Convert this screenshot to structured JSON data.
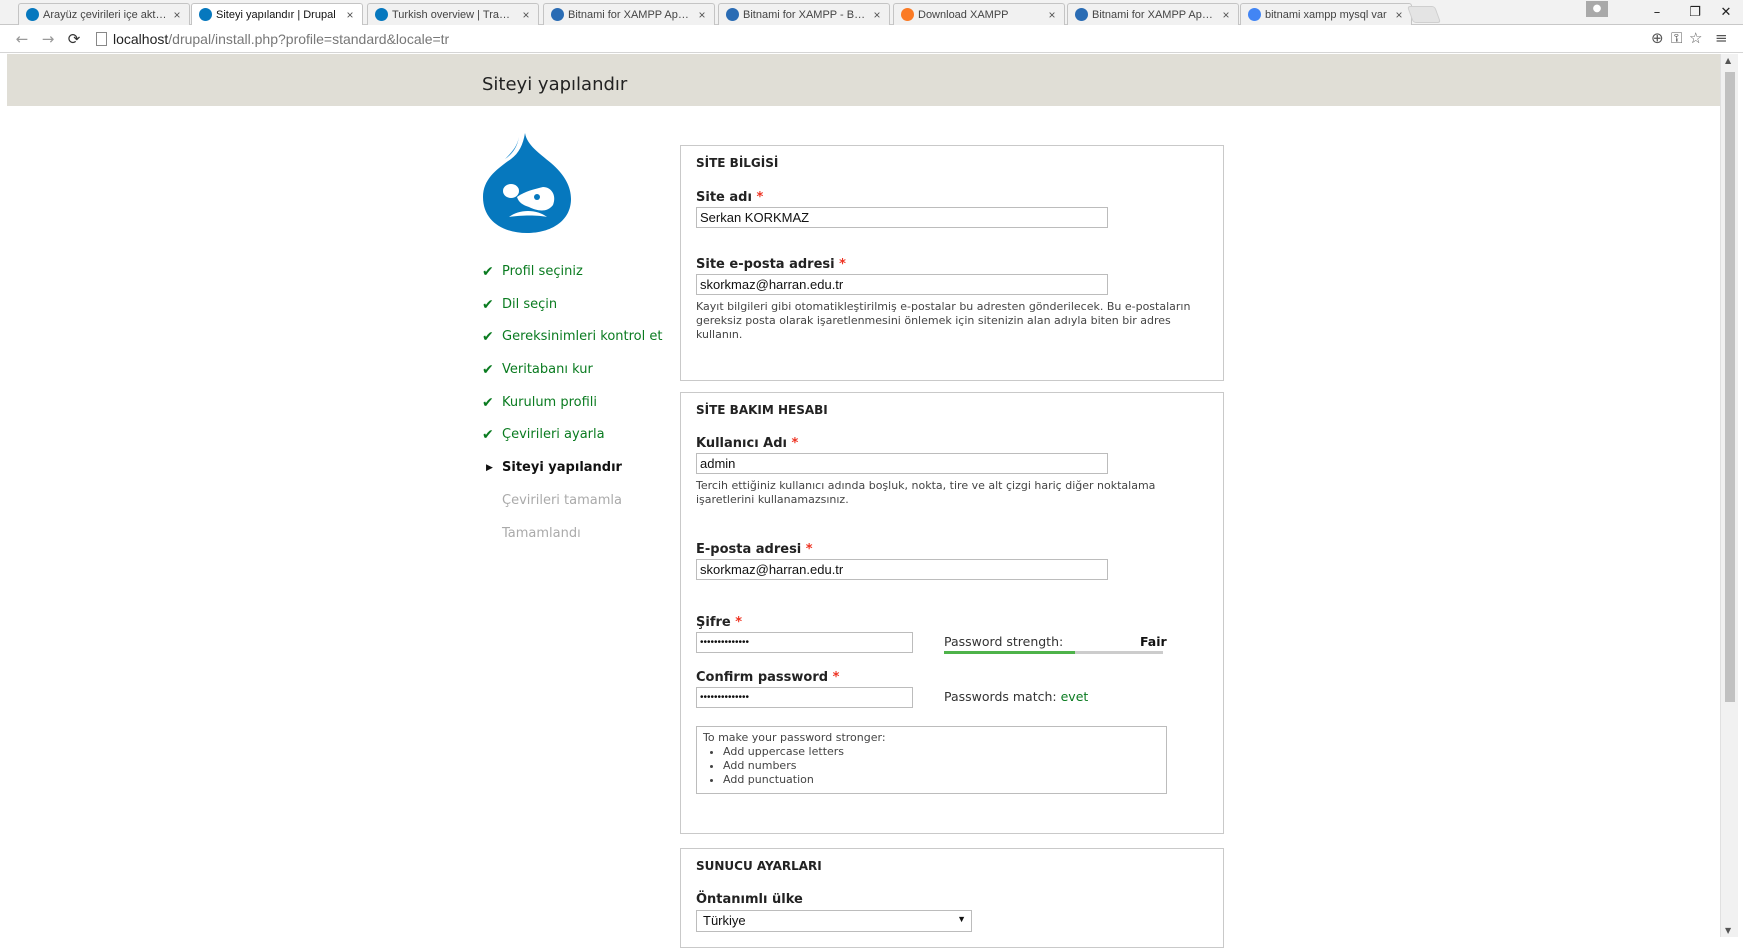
{
  "browser": {
    "tabs": [
      {
        "label": "Arayüz çevirileri içe aktarıl",
        "favicon": "drupal-icon",
        "color": "#0678be",
        "active": false
      },
      {
        "label": "Siteyi yapılandır | Drupal",
        "favicon": "drupal-icon",
        "color": "#0678be",
        "active": true
      },
      {
        "label": "Turkish overview | Translat",
        "favicon": "drupal-icon",
        "color": "#0678be",
        "active": false
      },
      {
        "label": "Bitnami for XAMPP Applic",
        "favicon": "bitnami-icon",
        "color": "#2a6cb4",
        "active": false
      },
      {
        "label": "Bitnami for XAMPP - Bitna",
        "favicon": "bitnami-icon",
        "color": "#2a6cb4",
        "active": false
      },
      {
        "label": "Download XAMPP",
        "favicon": "xampp-icon",
        "color": "#fb7a24",
        "active": false
      },
      {
        "label": "Bitnami for XAMPP Applic",
        "favicon": "bitnami-icon",
        "color": "#2a6cb4",
        "active": false
      },
      {
        "label": "bitnami xampp mysql var",
        "favicon": "google-icon",
        "color": "#4285f4",
        "active": false
      }
    ],
    "tab_close": "×",
    "window": {
      "minimize": "–",
      "restore": "❐",
      "close": "✕"
    },
    "url_host": "localhost",
    "url_path": "/drupal/install.php?profile=standard&locale=tr"
  },
  "page": {
    "title": "Siteyi yapılandır",
    "tasks": [
      {
        "label": "Profil seçiniz",
        "state": "done"
      },
      {
        "label": "Dil seçin",
        "state": "done"
      },
      {
        "label": "Gereksinimleri kontrol et",
        "state": "done"
      },
      {
        "label": "Veritabanı kur",
        "state": "done"
      },
      {
        "label": "Kurulum profili",
        "state": "done"
      },
      {
        "label": "Çevirileri ayarla",
        "state": "done"
      },
      {
        "label": "Siteyi yapılandır",
        "state": "active"
      },
      {
        "label": "Çevirileri tamamla",
        "state": "todo"
      },
      {
        "label": "Tamamlandı",
        "state": "todo"
      }
    ],
    "site_info": {
      "legend": "SİTE BİLGİSİ",
      "site_name_label": "Site adı",
      "site_name_value": "Serkan KORKMAZ",
      "site_email_label": "Site e-posta adresi",
      "site_email_value": "skorkmaz@harran.edu.tr",
      "site_email_desc": "Kayıt bilgileri gibi otomatikleştirilmiş e-postalar bu adresten gönderilecek. Bu e-postaların gereksiz posta olarak işaretlenmesini önlemek için sitenizin alan adıyla biten bir adres kullanın."
    },
    "account": {
      "legend": "SİTE BAKIM HESABI",
      "username_label": "Kullanıcı Adı",
      "username_value": "admin",
      "username_desc": "Tercih ettiğiniz kullanıcı adında boşluk, nokta, tire ve alt çizgi hariç diğer noktalama işaretlerini kullanamazsınız.",
      "email_label": "E-posta adresi",
      "email_value": "skorkmaz@harran.edu.tr",
      "password_label": "Şifre",
      "password_value": "••••••••••••••",
      "strength_label": "Password strength:",
      "strength_value": "Fair",
      "strength_fraction": 0.6,
      "confirm_label": "Confirm password",
      "confirm_value": "••••••••••••••",
      "match_label": "Passwords match:",
      "match_value": "evet",
      "suggest_title": "To make your password stronger:",
      "suggestions": [
        "Add uppercase letters",
        "Add numbers",
        "Add punctuation"
      ]
    },
    "server": {
      "legend": "SUNUCU AYARLARI",
      "country_label": "Öntanımlı ülke",
      "country_value": "Türkiye"
    },
    "required_mark": "*",
    "colors": {
      "accent_green": "#0a7b20",
      "required_red": "#e32",
      "header_band": "#e0ded6",
      "drupal_blue": "#0678be"
    }
  }
}
